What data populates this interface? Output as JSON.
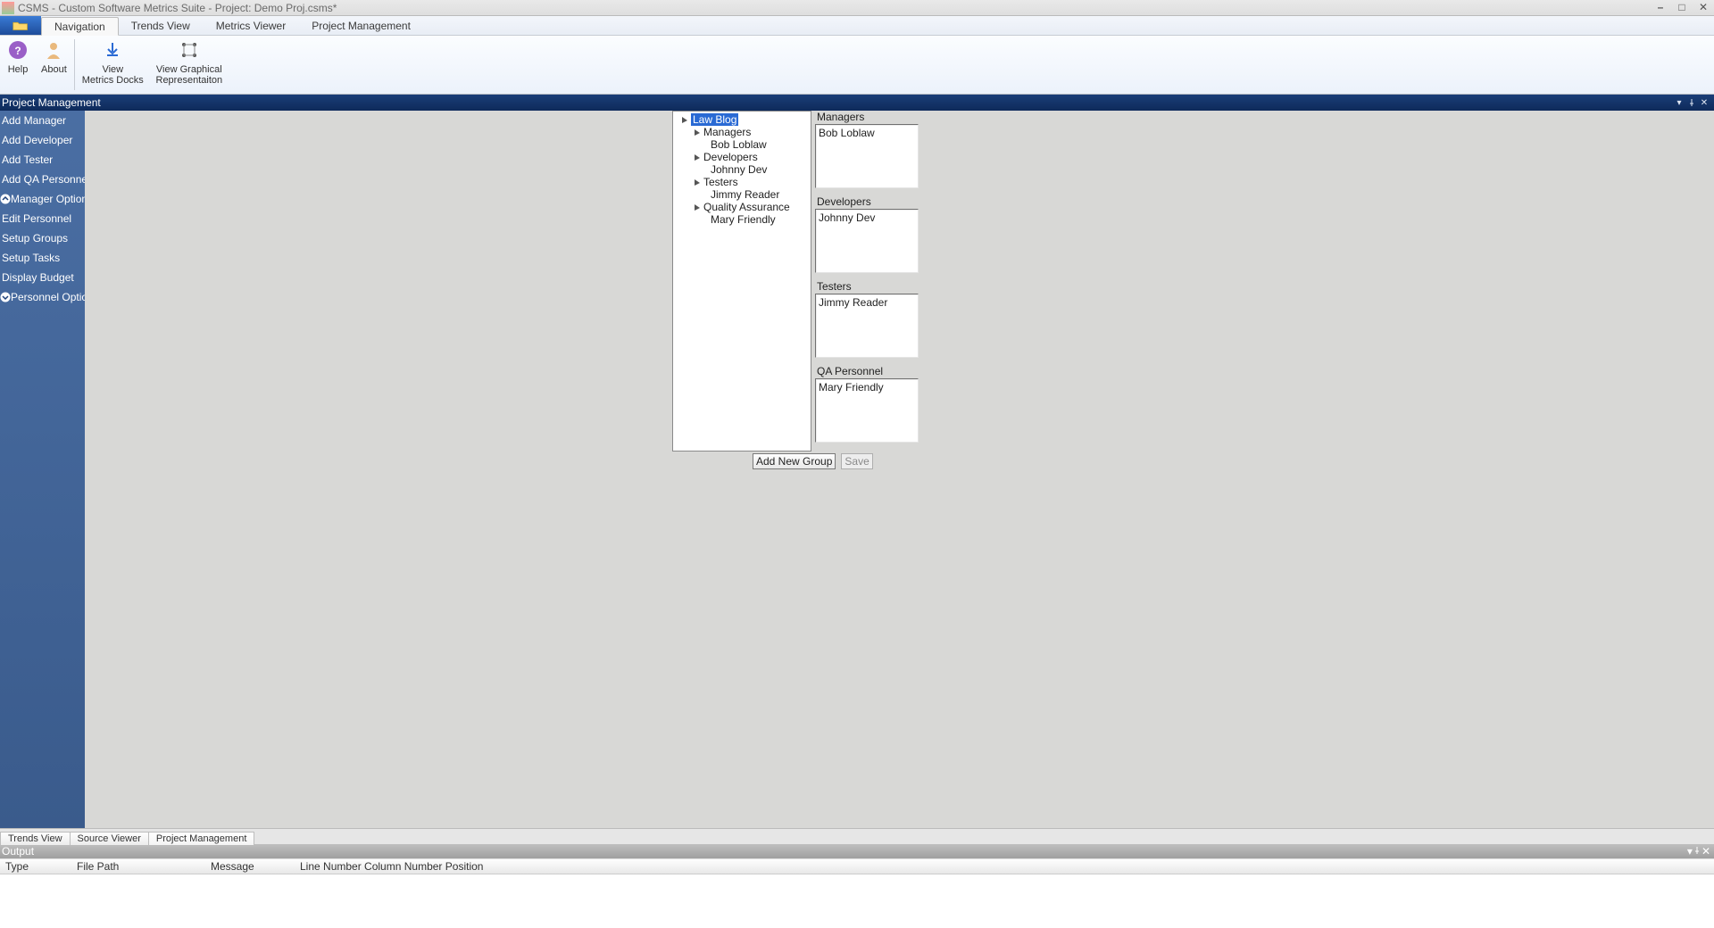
{
  "titlebar": {
    "text": "CSMS - Custom Software Metrics Suite - Project: Demo Proj.csms*"
  },
  "menu_tabs": [
    "Navigation",
    "Trends View",
    "Metrics Viewer",
    "Project Management"
  ],
  "active_menu_tab": 0,
  "ribbon": {
    "help": "Help",
    "about": "About",
    "view_metrics": "View\nMetrics Docks",
    "view_graph": "View Graphical\nRepresentaiton"
  },
  "dock_title": "Project Management",
  "sidebar": {
    "items": [
      "Add Manager",
      "Add Developer",
      "Add Tester",
      "Add QA Personnel",
      "Manager Options",
      "Edit Personnel",
      "Setup Groups",
      "Setup Tasks",
      "Display Budget",
      "Personnel Options"
    ]
  },
  "tree": {
    "root": "Law Blog",
    "groups": [
      {
        "name": "Managers",
        "members": [
          "Bob Loblaw"
        ]
      },
      {
        "name": "Developers",
        "members": [
          "Johnny Dev"
        ]
      },
      {
        "name": "Testers",
        "members": [
          "Jimmy Reader"
        ]
      },
      {
        "name": "Quality Assurance",
        "members": [
          "Mary Friendly"
        ]
      }
    ]
  },
  "right_panels": [
    {
      "label": "Managers",
      "value": "Bob Loblaw"
    },
    {
      "label": "Developers",
      "value": "Johnny Dev"
    },
    {
      "label": "Testers",
      "value": "Jimmy Reader"
    },
    {
      "label": "QA Personnel",
      "value": "Mary Friendly"
    }
  ],
  "buttons": {
    "add_group": "Add New Group",
    "save": "Save"
  },
  "bottom_tabs": [
    "Trends View",
    "Source Viewer",
    "Project Management"
  ],
  "active_bottom_tab": 2,
  "output": {
    "title": "Output",
    "headers": [
      "Type",
      "File Path",
      "Message",
      "Line Number",
      "Column Number",
      "Position"
    ]
  }
}
